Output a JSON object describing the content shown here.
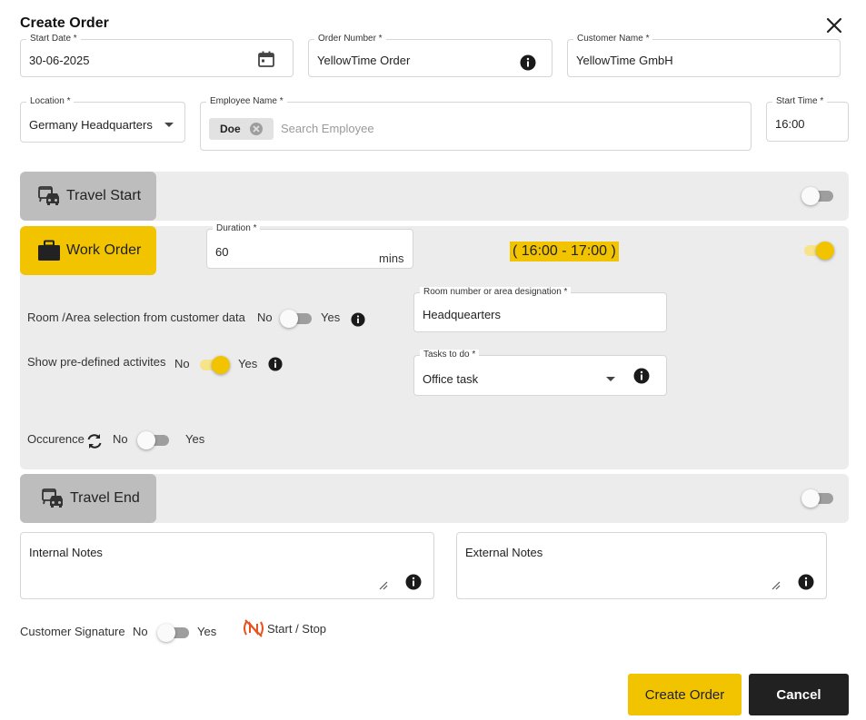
{
  "dialog": {
    "title": "Create Order"
  },
  "fields": {
    "start_date": {
      "label": "Start Date *",
      "value": "30-06-2025"
    },
    "order_number": {
      "label": "Order Number *",
      "value": "YellowTime Order"
    },
    "customer_name": {
      "label": "Customer Name *",
      "value": "YellowTime GmbH"
    },
    "location": {
      "label": "Location *",
      "value": "Germany Headquarters"
    },
    "employee": {
      "label": "Employee Name *",
      "chip": "Doe",
      "placeholder": "Search Employee"
    },
    "start_time": {
      "label": "Start Time *",
      "value": "16:00"
    }
  },
  "travel_start": {
    "label": "Travel Start",
    "enabled": false
  },
  "work_order": {
    "label": "Work Order",
    "enabled": true,
    "duration": {
      "label": "Duration *",
      "value": "60",
      "unit": "mins"
    },
    "time_range": "( 16:00 - 17:00 )",
    "room_selection": {
      "label": "Room /Area selection from customer data",
      "no": "No",
      "yes": "Yes",
      "enabled": false
    },
    "room_field": {
      "label": "Room number or area designation *",
      "value": "Headquearters"
    },
    "predefined": {
      "label": "Show pre-defined activites",
      "no": "No",
      "yes": "Yes",
      "enabled": true
    },
    "tasks": {
      "label": "Tasks to do *",
      "value": "Office task"
    },
    "occurrence": {
      "label": "Occurence",
      "no": "No",
      "yes": "Yes",
      "enabled": false
    }
  },
  "travel_end": {
    "label": "Travel End",
    "enabled": false
  },
  "notes": {
    "internal_label": "Internal Notes",
    "external_label": "External Notes"
  },
  "signature": {
    "label": "Customer Signature",
    "no": "No",
    "yes": "Yes",
    "enabled": false,
    "start_stop": "Start / Stop"
  },
  "actions": {
    "create": "Create Order",
    "cancel": "Cancel"
  },
  "colors": {
    "accent": "#f2c400",
    "dark": "#212121",
    "panel": "#ececec",
    "section_inactive": "#bdbdbd",
    "nfc_icon": "#e8521e"
  },
  "icons": [
    "close-icon",
    "calendar-icon",
    "info-icon",
    "chevron-down-icon",
    "chip-remove-icon",
    "travel-icon",
    "briefcase-icon",
    "sync-icon",
    "resize-icon",
    "nfc-off-icon"
  ]
}
